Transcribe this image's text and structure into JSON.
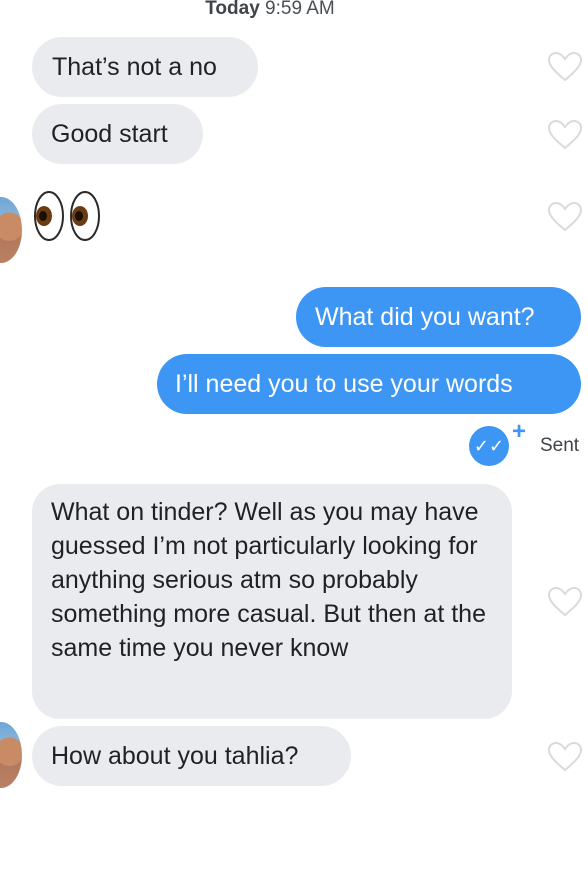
{
  "header": {
    "day": "Today",
    "time": "9:59 AM"
  },
  "messages": [
    {
      "id": "m1",
      "dir": "in",
      "text": "That’s not a no"
    },
    {
      "id": "m2",
      "dir": "in",
      "text": "Good start"
    },
    {
      "id": "m3",
      "dir": "in",
      "emoji": "👀"
    },
    {
      "id": "m4",
      "dir": "out",
      "text": "What did you want?"
    },
    {
      "id": "m5",
      "dir": "out",
      "text": "I’ll need you to use your words"
    },
    {
      "id": "m6",
      "dir": "in",
      "text": "What on tinder? Well as you may have guessed I’m not particularly looking for anything serious atm so probably something more casual. But then at the same time you never know"
    },
    {
      "id": "m7",
      "dir": "in",
      "text": "How about you tahlia?"
    }
  ],
  "receipt": {
    "status": "Sent",
    "plus": "+"
  },
  "icons": {
    "like": "heart-outline-icon",
    "read": "double-check-icon"
  },
  "colors": {
    "outgoing": "#3d96f4",
    "incoming": "#eaebee",
    "heart": "#d8dadd"
  }
}
